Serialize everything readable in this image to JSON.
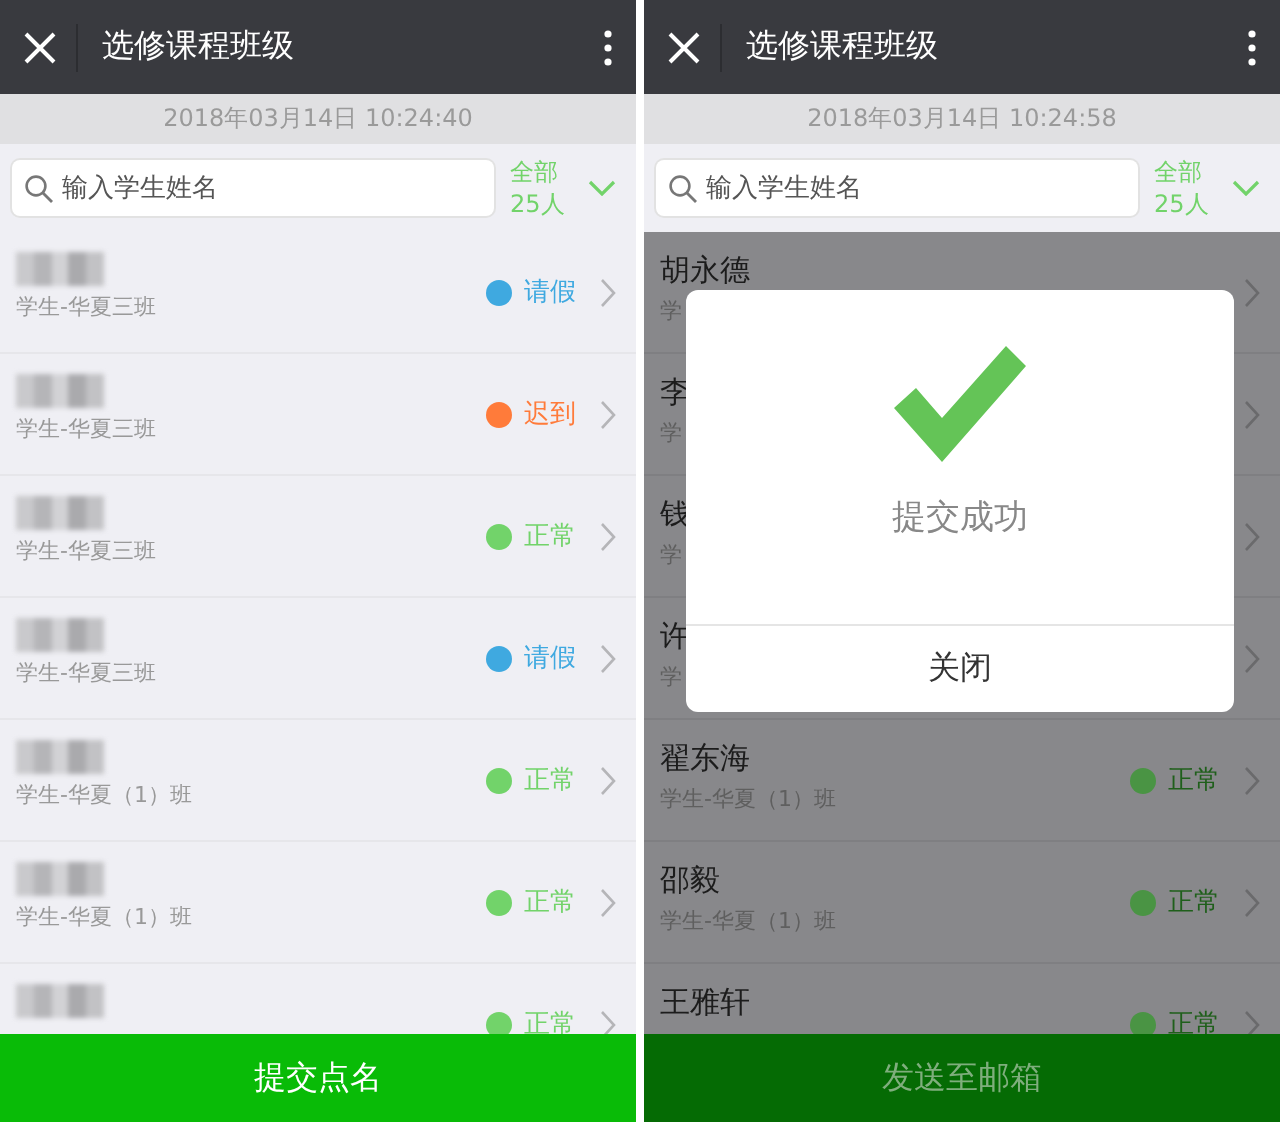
{
  "screens": [
    {
      "title": "选修课程班级",
      "timestamp": "2018年03月14日 10:24:40",
      "search": {
        "placeholder": "输入学生姓名"
      },
      "filter": {
        "label": "全部",
        "count": "25人"
      },
      "students": [
        {
          "sub": "学生-华夏三班",
          "status": "请假",
          "color": "#3fa9e0"
        },
        {
          "sub": "学生-华夏三班",
          "status": "迟到",
          "color": "#ff7b3a"
        },
        {
          "sub": "学生-华夏三班",
          "status": "正常",
          "color": "#72d36a"
        },
        {
          "sub": "学生-华夏三班",
          "status": "请假",
          "color": "#3fa9e0"
        },
        {
          "sub": "学生-华夏（1）班",
          "status": "正常",
          "color": "#72d36a"
        },
        {
          "sub": "学生-华夏（1）班",
          "status": "正常",
          "color": "#72d36a"
        },
        {
          "status": "正常",
          "color": "#72d36a"
        }
      ],
      "bottom_button": "提交点名"
    },
    {
      "title": "选修课程班级",
      "timestamp": "2018年03月14日 10:24:58",
      "search": {
        "placeholder": "输入学生姓名"
      },
      "filter": {
        "label": "全部",
        "count": "25人"
      },
      "students": [
        {
          "name": "胡永德",
          "sub": "学"
        },
        {
          "name": "李",
          "sub": "学"
        },
        {
          "name": "钱",
          "sub": "学"
        },
        {
          "name": "许",
          "sub": "学"
        },
        {
          "name": "翟东海",
          "sub": "学生-华夏（1）班",
          "status": "正常",
          "color": "#4a9444"
        },
        {
          "name": "邵毅",
          "sub": "学生-华夏（1）班",
          "status": "正常",
          "color": "#4a9444"
        },
        {
          "name": "王雅轩",
          "status": "正常",
          "color": "#4a9444"
        }
      ],
      "bottom_button": "发送至邮箱",
      "dialog": {
        "message": "提交成功",
        "button": "关闭"
      }
    }
  ]
}
